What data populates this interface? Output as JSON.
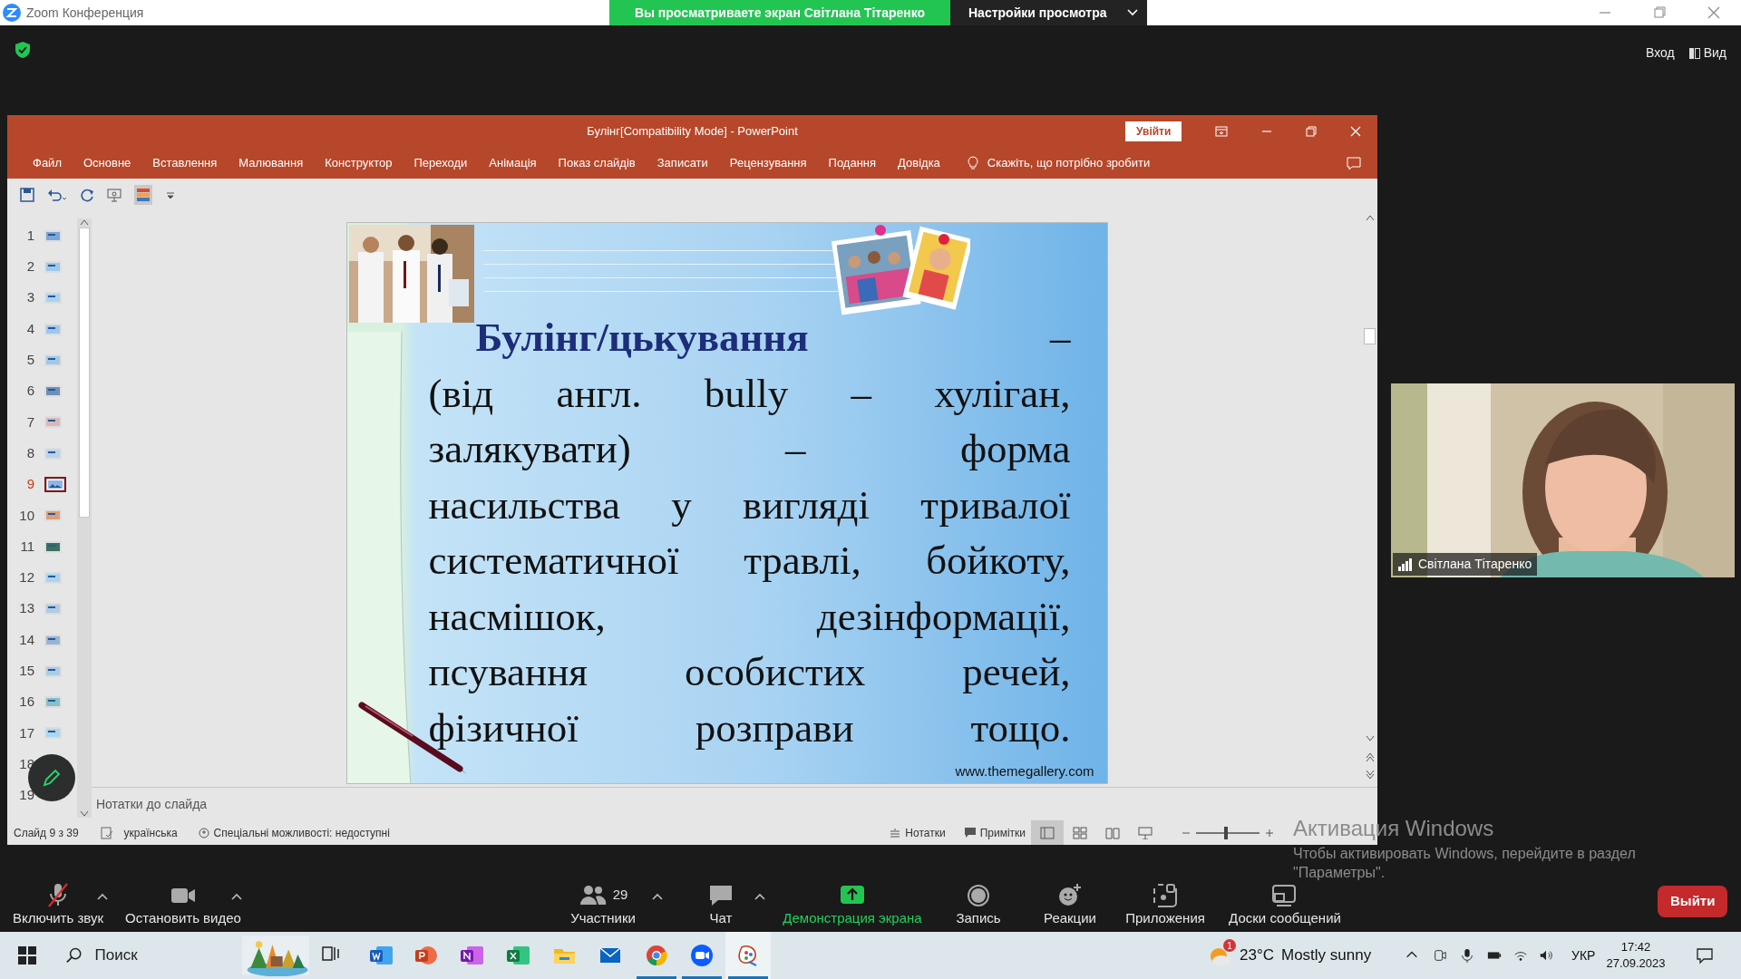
{
  "zoom_window": {
    "title": "Zoom Конференция",
    "banner": "Вы просматриваете экран Світлана Тітаренко",
    "view_options": "Настройки просмотра"
  },
  "top_right": [
    "Вход",
    "Вид"
  ],
  "powerpoint": {
    "title": "Булінг[Compatibility Mode]  -  PowerPoint",
    "sign_in": "Увійти",
    "tabs": [
      "Файл",
      "Основне",
      "Вставлення",
      "Малювання",
      "Конструктор",
      "Переходи",
      "Анімація",
      "Показ слайдів",
      "Записати",
      "Рецензування",
      "Подання",
      "Довідка"
    ],
    "tell_me": "Скажіть, що потрібно зробити",
    "thumbnails": [
      {
        "number": "1",
        "selected": false
      },
      {
        "number": "2",
        "selected": false
      },
      {
        "number": "3",
        "selected": false
      },
      {
        "number": "4",
        "selected": false
      },
      {
        "number": "5",
        "selected": false
      },
      {
        "number": "6",
        "selected": false
      },
      {
        "number": "7",
        "selected": false
      },
      {
        "number": "8",
        "selected": false
      },
      {
        "number": "9",
        "selected": true
      },
      {
        "number": "10",
        "selected": false
      },
      {
        "number": "11",
        "selected": false
      },
      {
        "number": "12",
        "selected": false
      },
      {
        "number": "13",
        "selected": false
      },
      {
        "number": "14",
        "selected": false
      },
      {
        "number": "15",
        "selected": false
      },
      {
        "number": "16",
        "selected": false
      },
      {
        "number": "17",
        "selected": false
      },
      {
        "number": "18",
        "selected": false
      },
      {
        "number": "19",
        "selected": false
      }
    ],
    "slide": {
      "title": "Булінг/цькування",
      "dash": "–",
      "lines": [
        "(від англ. bully – хуліган,",
        "залякувати) – форма",
        "насильства у вигляді тривалої",
        "систематичної травлі, бойкоту,",
        "насмішок, дезінформації,",
        "псування особистих речей,",
        "фізичної розправи тощо."
      ],
      "website": "www.themegallery.com"
    },
    "notes_placeholder": "Нотатки до слайда",
    "status": {
      "slide": "Слайд 9 з 39",
      "language": "українська",
      "accessibility": "Спеціальні можливості: недоступні",
      "notes": "Нотатки",
      "comments": "Примітки",
      "zoom": {
        "level": 0.47
      }
    }
  },
  "video": {
    "name": "Світлана Тітаренко"
  },
  "activation": {
    "title": "Активация Windows",
    "text": "Чтобы активировать Windows, перейдите в раздел \"Параметры\"."
  },
  "toolbar": [
    {
      "kind": "mic",
      "label": "Включить звук",
      "muted": true
    },
    {
      "kind": "video",
      "label": "Остановить видео"
    },
    {
      "kind": "participants",
      "label": "Участники",
      "count": "29"
    },
    {
      "kind": "chat",
      "label": "Чат"
    },
    {
      "kind": "share",
      "label": "Демонстрация экрана"
    },
    {
      "kind": "record",
      "label": "Запись"
    },
    {
      "kind": "reactions",
      "label": "Реакции"
    },
    {
      "kind": "apps",
      "label": "Приложения"
    },
    {
      "kind": "boards",
      "label": "Доски сообщений"
    }
  ],
  "leave": "Выйти",
  "taskbar": {
    "search": {
      "placeholder": "Поиск"
    },
    "apps": [
      {
        "kind": "taskview",
        "running": false,
        "active": false
      },
      {
        "kind": "word",
        "running": false,
        "active": false
      },
      {
        "kind": "powerpoint",
        "running": false,
        "active": false
      },
      {
        "kind": "onenote",
        "running": false,
        "active": false
      },
      {
        "kind": "excel",
        "running": false,
        "active": false
      },
      {
        "kind": "explorer",
        "running": false,
        "active": false
      },
      {
        "kind": "mail",
        "running": false,
        "active": false
      },
      {
        "kind": "chrome",
        "running": true,
        "active": false
      },
      {
        "kind": "zoom",
        "running": true,
        "active": false
      },
      {
        "kind": "paint",
        "running": true,
        "active": true
      }
    ],
    "weather": {
      "badge": "1",
      "temp": "23°C",
      "text": "Mostly sunny"
    },
    "language": "УКР",
    "time": "17:42",
    "date": "27.09.2023"
  }
}
